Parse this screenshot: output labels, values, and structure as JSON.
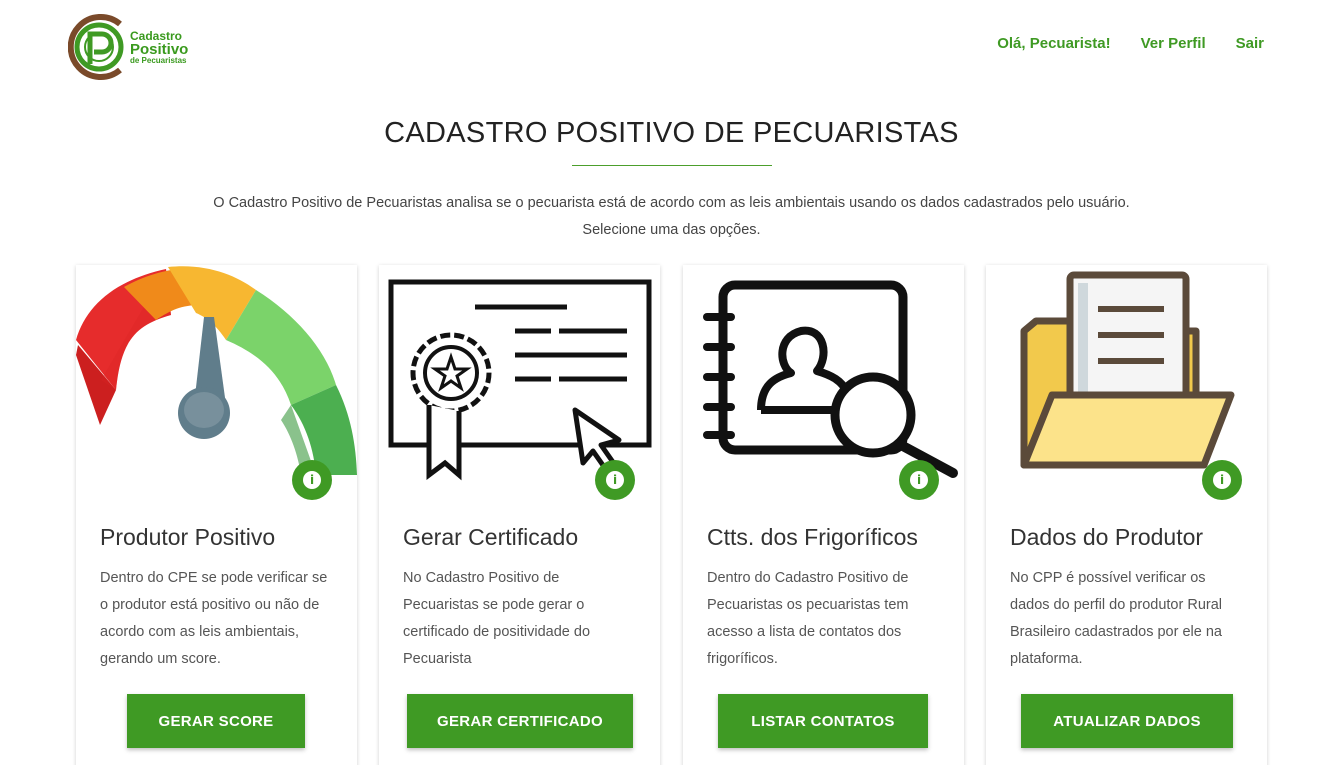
{
  "logo": {
    "line1": "Cadastro",
    "line2": "Positivo",
    "line3": "de Pecuaristas"
  },
  "nav": {
    "greeting": "Olá, Pecuarista!",
    "profile": "Ver Perfil",
    "logout": "Sair"
  },
  "main": {
    "title": "CADASTRO POSITIVO DE PECUARISTAS",
    "intro_line1": "O Cadastro Positivo de Pecuaristas analisa se o pecuarista está de acordo com as leis ambientais usando os dados cadastrados pelo usuário.",
    "intro_line2": "Selecione uma das opções."
  },
  "cards": [
    {
      "icon": "gauge-icon",
      "title": "Produtor Positivo",
      "description": "Dentro do CPE se pode verificar se o produtor está positivo ou não de acordo com as leis ambientais, gerando um score.",
      "button": "GERAR SCORE"
    },
    {
      "icon": "certificate-icon",
      "title": "Gerar Certificado",
      "description": "No Cadastro Positivo de Pecuaristas se pode gerar o certificado de positividade do Pecuarista",
      "button": "GERAR CERTIFICADO"
    },
    {
      "icon": "contact-book-search-icon",
      "title": "Ctts. dos Frigoríficos",
      "description": "Dentro do Cadastro Positivo de Pecuaristas os pecuaristas tem acesso a lista de contatos dos frigoríficos.",
      "button": "LISTAR CONTATOS"
    },
    {
      "icon": "folder-document-icon",
      "title": "Dados do Produtor",
      "description": "No CPP é possível verificar os dados do perfil do produtor Rural Brasileiro cadastrados por ele na plataforma.",
      "button": "ATUALIZAR DADOS"
    }
  ],
  "info_icon_glyph": "i",
  "colors": {
    "primary_green": "#3f9a24",
    "logo_brown": "#7a4a2a"
  }
}
